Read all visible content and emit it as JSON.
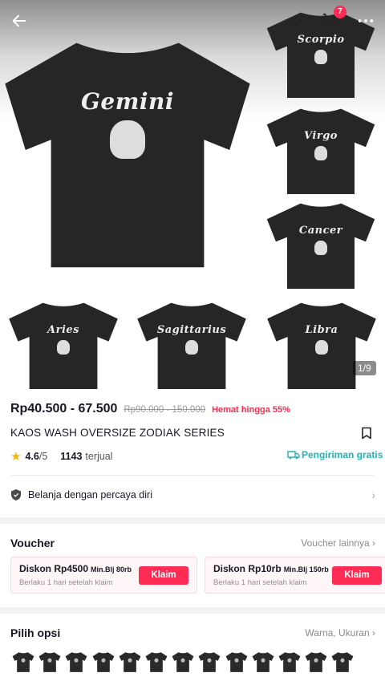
{
  "header": {
    "cart_badge": "7",
    "icons": [
      "arrow-left-icon",
      "share-icon",
      "cart-icon",
      "more-icon"
    ]
  },
  "gallery": {
    "main_print": "Gemini",
    "thumb_prints": [
      "Scorpio",
      "Virgo",
      "Cancer",
      "Aries",
      "Sagittarius",
      "Libra"
    ],
    "page_counter": "1/9"
  },
  "product": {
    "price": "Rp40.500 - 67.500",
    "original_price": "Rp90.000 - 150.000",
    "discount": "Hemat hingga 55%",
    "title": "KAOS WASH OVERSIZE ZODIAK SERIES",
    "rating": "4.6",
    "rating_max": "/5",
    "sold_count": "1143",
    "sold_label": "terjual",
    "shipping": "Pengiriman gratis",
    "trust": "Belanja dengan percaya diri"
  },
  "voucher": {
    "title": "Voucher",
    "more": "Voucher lainnya",
    "cards": [
      {
        "title": "Diskon Rp4500",
        "min": "Min.Blj 80rb",
        "subtitle": "Berlaku 1 hari setelah klaim",
        "button": "Klaim"
      },
      {
        "title": "Diskon Rp10rb",
        "min": "Min.Blj 150rb",
        "subtitle": "Berlaku 1 hari setelah klaim",
        "button": "Klaim"
      }
    ]
  },
  "options": {
    "title": "Pilih opsi",
    "subtitle": "Warna, Ukuran",
    "swatch_count": 13
  },
  "colors": {
    "accent": "#fe2c55",
    "shipping": "#20b4b4",
    "shirt": "#2a2a2a"
  }
}
